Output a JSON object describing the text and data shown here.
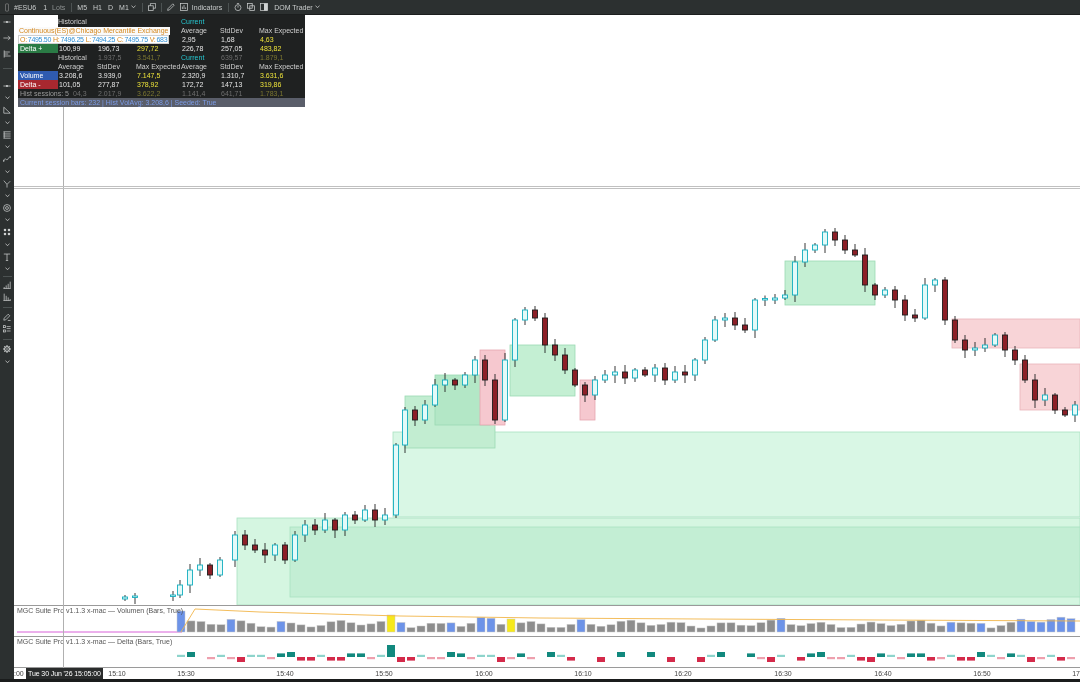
{
  "toolbar": {
    "symbol": "#ESU6",
    "lot_quantity": "1",
    "lot_unit": "Lots",
    "timeframes": [
      "M5",
      "H1",
      "D"
    ],
    "timeframe_dropdown": "M1",
    "indicators_button": "Indicators",
    "dom_trader_button": "DOM Trader"
  },
  "chart": {
    "legend": {
      "title": "Continuous(ES)@Chicago Mercantile Exchange",
      "ohlc": [
        {
          "key": "O:",
          "value": "7495.50"
        },
        {
          "key": "H:",
          "value": "7496.25"
        },
        {
          "key": "L:",
          "value": "7494.25"
        },
        {
          "key": "C:",
          "value": "7495.75"
        },
        {
          "key": "V:",
          "value": "683"
        }
      ]
    },
    "stats_tables": [
      {
        "historical_header": "Historical",
        "current_header": "Current",
        "column_headers": {
          "current_average": "Average",
          "current_stddev": "StdDev",
          "current_max_expected": "Max Expected"
        },
        "rows": [
          {
            "kind": "volume",
            "values": {
              "current_average": "2,95",
              "current_stddev": "1,68",
              "current_max_expected": "4,63"
            }
          },
          {
            "kind": "delta_positive",
            "label": "Delta +",
            "values": {
              "historical_average": "100,99",
              "historical_stddev": "196,73",
              "historical_max_expected": "297,72",
              "current_average": "226,78",
              "current_stddev": "257,05",
              "current_max_expected": "483,82"
            }
          },
          {
            "kind": "sessions",
            "values": {
              "historical_stddev": "1.937,5",
              "historical_max_expected": "3.541,7",
              "current_stddev": "639,57",
              "current_max_expected": "1.879,1"
            }
          }
        ]
      },
      {
        "historical_header": "Historical",
        "current_header": "Current",
        "column_headers": {
          "historical_average": "Average",
          "historical_stddev": "StdDev",
          "historical_max_expected": "Max Expected",
          "current_average": "Average",
          "current_stddev": "StdDev",
          "current_max_expected": "Max Expected"
        },
        "rows": [
          {
            "kind": "volume",
            "label": "Volume",
            "values": {
              "historical_average": "3.208,6",
              "historical_stddev": "3.939,0",
              "historical_max_expected": "7.147,5",
              "current_average": "2.320,9",
              "current_stddev": "1.310,7",
              "current_max_expected": "3.631,6"
            }
          },
          {
            "kind": "delta_negative",
            "label": "Delta -",
            "values": {
              "historical_average": "101,05",
              "historical_stddev": "277,87",
              "historical_max_expected": "378,92",
              "current_average": "172,72",
              "current_stddev": "147,13",
              "current_max_expected": "319,86"
            }
          },
          {
            "kind": "sessions",
            "label": "Hist sessions: 5",
            "values": {
              "historical_average": "04,3",
              "historical_stddev": "2.017,9",
              "historical_max_expected": "3.622,2",
              "current_average": "1.141,4",
              "current_stddev": "641,71",
              "current_max_expected": "1.783,1"
            }
          }
        ],
        "footer": "Current session bars: 232 | Hist VolAvg: 3.208,6 | Seeded: True"
      }
    ],
    "panes": [
      {
        "kind": "volume",
        "label": "MGC Suite Pro v1.1.3 x-mac — Volumen (Bars, True)"
      },
      {
        "kind": "delta",
        "label": "MGC Suite Pro v1.1.3 x-mac — Delta (Bars, True)"
      }
    ],
    "time_axis": {
      "labels": [
        ":00",
        "15:10",
        "15:30",
        "15:40",
        "15:50",
        "16:00",
        "16:10",
        "16:20",
        "16:30",
        "16:40",
        "16:50",
        "17"
      ],
      "cursor_label": "Tue 30 Jun '26 15:05:00"
    }
  }
}
